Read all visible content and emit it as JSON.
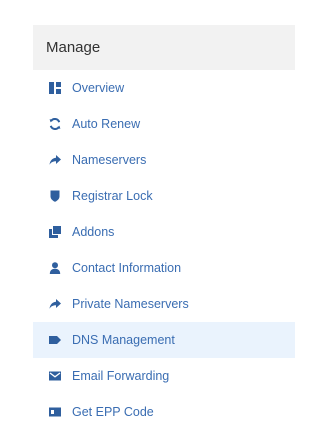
{
  "panel": {
    "title": "Manage"
  },
  "menu": {
    "items": [
      {
        "label": "Overview",
        "icon": "dashboard-icon"
      },
      {
        "label": "Auto Renew",
        "icon": "sync-icon"
      },
      {
        "label": "Nameservers",
        "icon": "share-arrow-icon"
      },
      {
        "label": "Registrar Lock",
        "icon": "shield-icon"
      },
      {
        "label": "Addons",
        "icon": "copy-icon"
      },
      {
        "label": "Contact Information",
        "icon": "user-icon"
      },
      {
        "label": "Private Nameservers",
        "icon": "share-arrow-icon"
      },
      {
        "label": "DNS Management",
        "icon": "tag-icon",
        "active": true
      },
      {
        "label": "Email Forwarding",
        "icon": "mail-icon"
      },
      {
        "label": "Get EPP Code",
        "icon": "id-card-icon"
      }
    ]
  },
  "colors": {
    "link": "#3a6db2",
    "icon": "#2f5f9e",
    "header_bg": "#f2f2f2",
    "active_bg": "#eaf3fd"
  }
}
